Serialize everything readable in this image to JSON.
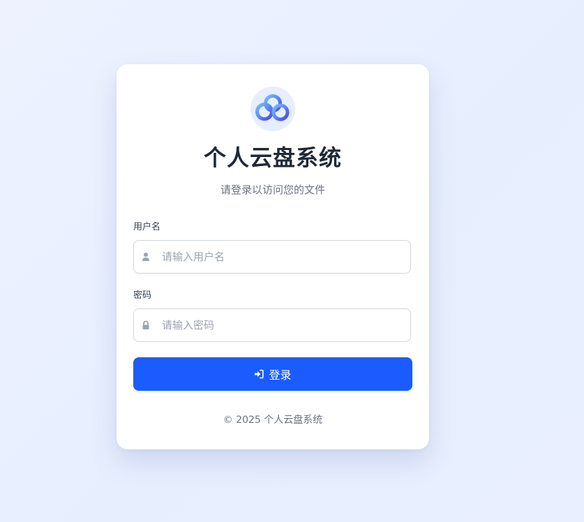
{
  "app": {
    "title": "个人云盘系统",
    "subtitle": "请登录以访问您的文件",
    "logo_icon": "cloud-logo-icon"
  },
  "form": {
    "username": {
      "label": "用户名",
      "placeholder": "请输入用户名",
      "value": "",
      "icon": "user-icon"
    },
    "password": {
      "label": "密码",
      "placeholder": "请输入密码",
      "value": "",
      "icon": "lock-icon"
    },
    "submit": {
      "label": "登录",
      "icon": "sign-in-icon"
    }
  },
  "footer": {
    "text": "© 2025 个人云盘系统"
  },
  "colors": {
    "primary": "#1a5cff",
    "background": "#e9efff",
    "title": "#1f2937",
    "muted": "#6b7280"
  }
}
